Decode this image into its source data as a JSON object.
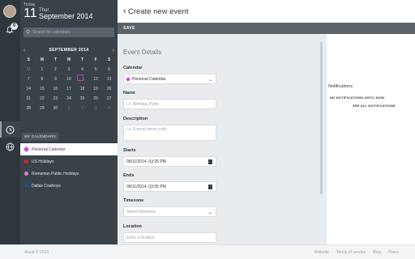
{
  "rail": {
    "notification_count": "0"
  },
  "today": {
    "label": "Today",
    "day_number": "11",
    "day_name": "Thur",
    "month_year": "September 2014"
  },
  "search": {
    "placeholder": "Search for calendars"
  },
  "mini_calendar": {
    "title": "SEPTEMBER 2014",
    "weekdays": [
      "S",
      "M",
      "T",
      "W",
      "T",
      "F",
      "S"
    ],
    "weeks": [
      [
        "31",
        "1",
        "2",
        "3",
        "4",
        "5",
        "6"
      ],
      [
        "7",
        "8",
        "9",
        "10",
        "11",
        "12",
        "13"
      ],
      [
        "14",
        "15",
        "16",
        "17",
        "18",
        "19",
        "20"
      ],
      [
        "21",
        "22",
        "23",
        "24",
        "25",
        "26",
        "27"
      ],
      [
        "28",
        "29",
        "30",
        "1",
        "2",
        "3",
        "4"
      ]
    ]
  },
  "my_calendars": {
    "tab_label": "MY CALENDARS",
    "items": [
      {
        "label": "Personal Calendar",
        "color": "#e040e0"
      },
      {
        "label": "US Holidays",
        "color": "#d8262e"
      },
      {
        "label": "Romanian Public Holidays",
        "color": "#ee79c9"
      },
      {
        "label": "Dallas Cowboys",
        "color": "#1f4fa6"
      }
    ]
  },
  "header": {
    "back_glyph": "‹",
    "title": "Create new event"
  },
  "toolbar": {
    "save_label": "SAVE"
  },
  "form": {
    "section_title": "Event Details",
    "calendar_label": "Calendar",
    "calendar_value": "Personal Calendar",
    "name_label": "Name",
    "name_placeholder": "i.e. Birthday Party",
    "description_label": "Description",
    "description_placeholder": "i.e. Formal dress code",
    "starts_label": "Starts",
    "starts_value": "09/11/2014, 03:25 PM",
    "ends_label": "Ends",
    "ends_value": "09/11/2014, 03:55 PM",
    "timezone_label": "Timezone",
    "timezone_placeholder": "Select timezone",
    "location_label": "Location",
    "location_placeholder": "Enter a location"
  },
  "notifications": {
    "title": "Notifications",
    "message": "NO NOTIFICATIONS UNTIL NOW.",
    "see_all": "SEE ALL NOTIFICATIONS"
  },
  "footer": {
    "copyright": "Aksat © 2014",
    "links": [
      "Website",
      "Terms of service",
      "Blog",
      "Press"
    ]
  }
}
